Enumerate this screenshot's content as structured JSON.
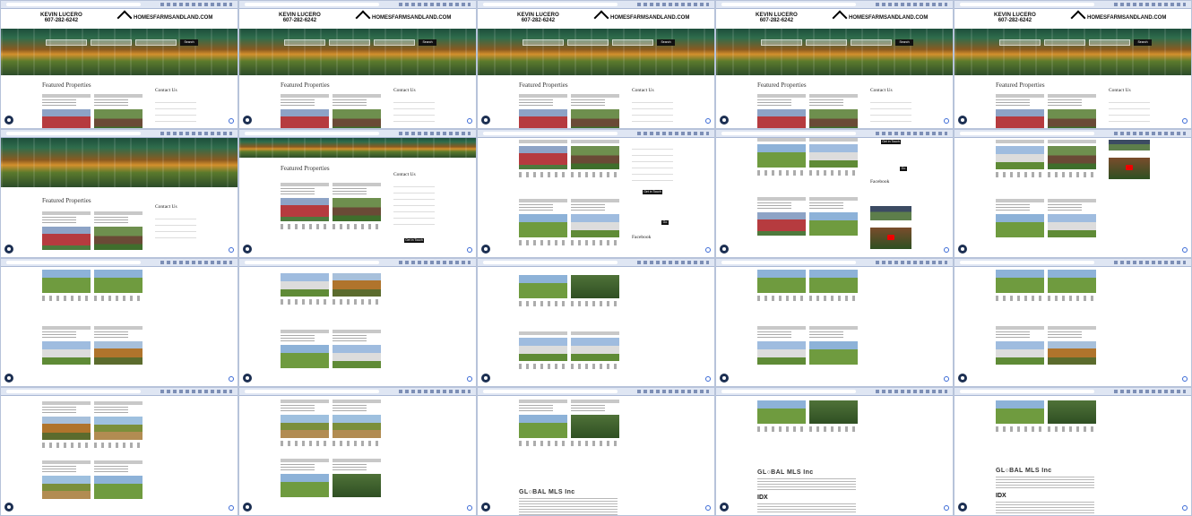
{
  "site": {
    "agent_name": "KEVIN LUCERO",
    "agent_phone": "607-282-6242",
    "logo_text": "HOMESFARMSANDLAND.COM",
    "search_button": "Search",
    "featured_title": "Featured Properties",
    "contact_title": "Contact Us",
    "facebook_title": "Facebook",
    "contact_button": "Get in Touch",
    "go_button": "Go",
    "mls_title": "GL○BAL MLS Inc",
    "idx_label": "IDX"
  },
  "frames": [
    {
      "id": "f1",
      "view": "top"
    },
    {
      "id": "f2",
      "view": "top"
    },
    {
      "id": "f3",
      "view": "top"
    },
    {
      "id": "f4",
      "view": "top"
    },
    {
      "id": "f5",
      "view": "top"
    },
    {
      "id": "f6",
      "view": "top"
    },
    {
      "id": "f7",
      "view": "top-scrolled"
    },
    {
      "id": "f8",
      "view": "cards-contact"
    },
    {
      "id": "f9",
      "view": "cards-facebook"
    },
    {
      "id": "f10",
      "view": "cards-video"
    },
    {
      "id": "f11",
      "view": "cards"
    },
    {
      "id": "f12",
      "view": "cards"
    },
    {
      "id": "f13",
      "view": "cards"
    },
    {
      "id": "f14",
      "view": "cards"
    },
    {
      "id": "f15",
      "view": "cards"
    },
    {
      "id": "f16",
      "view": "cards"
    },
    {
      "id": "f17",
      "view": "cards"
    },
    {
      "id": "f18",
      "view": "cards-mls"
    },
    {
      "id": "f19",
      "view": "cards-mls-idx"
    },
    {
      "id": "f20",
      "view": "cards-mls-idx"
    }
  ]
}
